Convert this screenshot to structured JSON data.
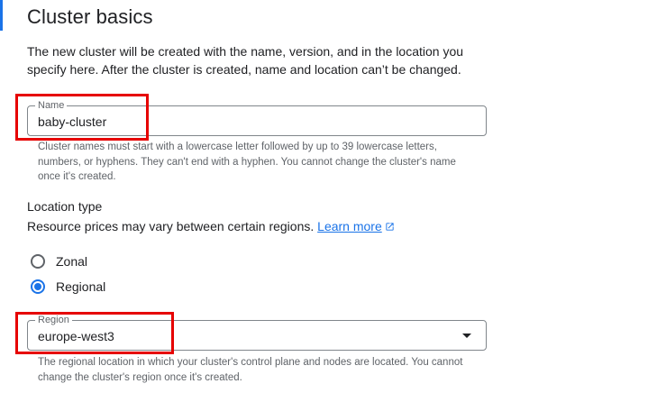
{
  "section": {
    "title": "Cluster basics",
    "intro": "The new cluster will be created with the name, version, and in the location you specify here. After the cluster is created, name and location can’t be changed."
  },
  "name_field": {
    "label": "Name",
    "value": "baby-cluster",
    "hint": "Cluster names must start with a lowercase letter followed by up to 39 lowercase letters, numbers, or hyphens. They can't end with a hyphen. You cannot change the cluster's name once it's created."
  },
  "location": {
    "heading": "Location type",
    "note": "Resource prices may vary between certain regions.",
    "link_label": "Learn more",
    "options": [
      {
        "label": "Zonal",
        "selected": false
      },
      {
        "label": "Regional",
        "selected": true
      }
    ]
  },
  "region_field": {
    "label": "Region",
    "value": "europe-west3",
    "hint": "The regional location in which your cluster's control plane and nodes are located. You cannot change the cluster's region once it's created."
  },
  "colors": {
    "accent": "#1a73e8",
    "highlight": "#e60000",
    "hint_text": "#5f6368"
  },
  "icons": {
    "external_link": "open-in-new-icon",
    "dropdown": "arrow-drop-down-icon"
  }
}
